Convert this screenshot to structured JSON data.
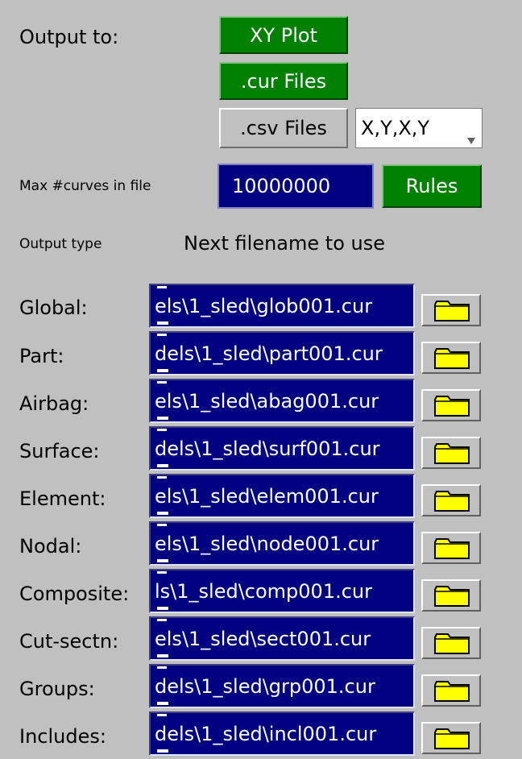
{
  "output": {
    "label": "Output to:",
    "xy_plot": "XY Plot",
    "cur_files": ".cur Files",
    "csv_files": ".csv Files",
    "csv_format": "X,Y,X,Y"
  },
  "max_curves": {
    "label": "Max #curves in file",
    "value": "10000000",
    "rules_button": "Rules"
  },
  "headers": {
    "output_type": "Output type",
    "next_filename": "Next filename to use"
  },
  "rows": [
    {
      "label": "Global:",
      "filename": "els\\1_sled\\glob001.cur"
    },
    {
      "label": "Part:",
      "filename": "dels\\1_sled\\part001.cur"
    },
    {
      "label": "Airbag:",
      "filename": "els\\1_sled\\abag001.cur"
    },
    {
      "label": "Surface:",
      "filename": "dels\\1_sled\\surf001.cur"
    },
    {
      "label": "Element:",
      "filename": "els\\1_sled\\elem001.cur"
    },
    {
      "label": "Nodal:",
      "filename": "els\\1_sled\\node001.cur"
    },
    {
      "label": "Composite:",
      "filename": "ls\\1_sled\\comp001.cur"
    },
    {
      "label": "Cut-sectn:",
      "filename": "els\\1_sled\\sect001.cur"
    },
    {
      "label": "Groups:",
      "filename": "dels\\1_sled\\grp001.cur"
    },
    {
      "label": "Includes:",
      "filename": "dels\\1_sled\\incl001.cur"
    }
  ],
  "icons": {
    "folder": "folder-icon",
    "dropdown": "dropdown-arrow-icon"
  },
  "colors": {
    "green": "#008000",
    "navy": "#000080",
    "panel": "#c0c0c0",
    "folder": "#ffff00"
  }
}
